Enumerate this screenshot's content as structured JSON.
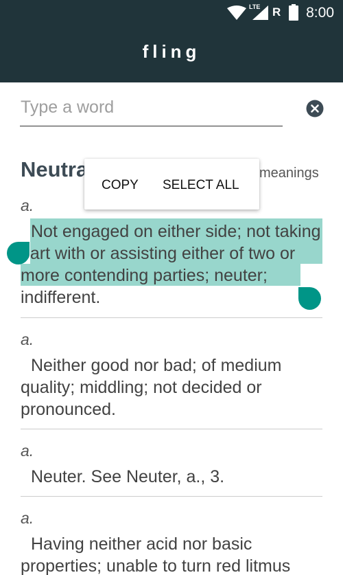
{
  "status_bar": {
    "time": "8:00",
    "network_label": "LTE",
    "roaming_label": "R",
    "icons": [
      "wifi-icon",
      "signal-icon",
      "battery-icon"
    ]
  },
  "app_bar": {
    "title": "fling"
  },
  "search": {
    "placeholder": "Type a word",
    "value": ""
  },
  "word": {
    "heading": "Neutra",
    "meanings_link": "meanings"
  },
  "context_menu": {
    "copy": "COPY",
    "select_all": "SELECT ALL"
  },
  "definitions": [
    {
      "pos": "a.",
      "text": "Not engaged on either side; not taking part with or assisting either of two or more contending parties; neuter; indifferent."
    },
    {
      "pos": "a.",
      "text": "Neither good nor bad; of medium quality; middling; not decided or pronounced."
    },
    {
      "pos": "a.",
      "text": "Neuter. See Neuter, a., 3."
    },
    {
      "pos": "a.",
      "text": "Having neither acid nor basic properties; unable to turn red litmus"
    }
  ],
  "colors": {
    "app_bar": "#20343a",
    "selection": "#98d6cc",
    "selection_handle": "#009587",
    "clear_button": "#3d4b55"
  }
}
